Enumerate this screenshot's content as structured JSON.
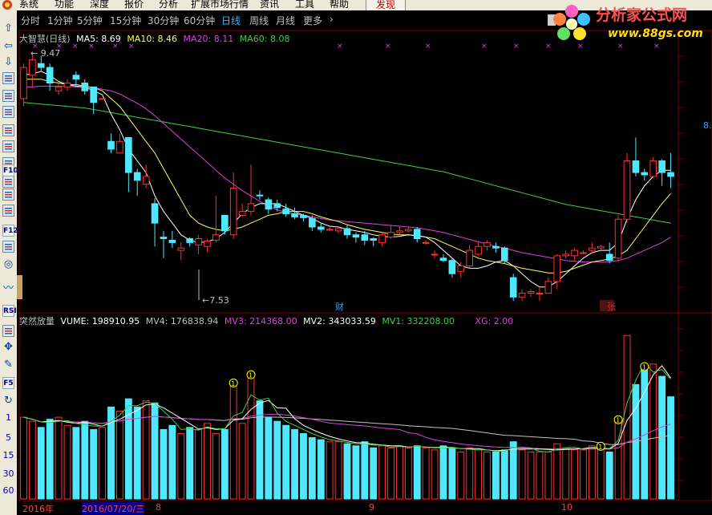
{
  "menu": {
    "items": [
      "系统",
      "功能",
      "深度",
      "报价",
      "分析",
      "扩展市场行情",
      "资讯",
      "工具",
      "帮助"
    ],
    "highlight": "发现"
  },
  "tabs": {
    "items": [
      "分时",
      "1分钟",
      "5分钟",
      "15分钟",
      "30分钟",
      "60分钟",
      "日线",
      "周线",
      "月线",
      "更多",
      "›"
    ],
    "active_index": 6
  },
  "toolbar": {
    "icons": [
      "arrow-up-icon",
      "arrow-left-icon",
      "arrow-down-icon",
      "stock-list-icon",
      "grid-icon",
      "table-icon",
      "line-chart-icon",
      "bar-chart-icon",
      "candlestick-icon",
      "list-icon",
      "f10-icon",
      "report-icon",
      "doc-icon",
      "f12-icon",
      "finance-icon",
      "circle-icon",
      "wave-icon",
      "rsi-icon",
      "ruler-icon",
      "move-icon",
      "pencil-icon",
      "f5-icon",
      "refresh-icon"
    ],
    "labels": {
      "f10": "F10",
      "f12": "F12",
      "rsi": "RSI",
      "f5": "F5"
    },
    "numbers": [
      "1",
      "5",
      "15",
      "30",
      "60"
    ]
  },
  "kline_header": {
    "title": "大智慧(日线)",
    "ma5": "MA5: 8.69",
    "ma10": "MA10: 8.46",
    "ma20": "MA20: 8.11",
    "ma60": "MA60: 8.08"
  },
  "kline_annotations": {
    "high": "9.47",
    "low": "7.53",
    "marker_cai": "财",
    "marker_zhang": "张",
    "right_price": "8."
  },
  "vol_header": {
    "title": "突然放量",
    "vume": "VUME: 198910.95",
    "mv4": "MV4: 176838.94",
    "mv3": "MV3: 214368.00",
    "mv2": "MV2: 343033.59",
    "mv1": "MV1: 332208.00",
    "xg": "XG: 2.00"
  },
  "logo": {
    "text": "分析家公式网",
    "url": "www.88gs.com"
  },
  "date_axis": {
    "year": "2016年",
    "selected": "2016/07/20/三",
    "m8": "8",
    "m9": "9",
    "m10": "10"
  },
  "colors": {
    "up": "#ff3030",
    "down": "#50e8ff",
    "ma5": "#ffffff",
    "ma10": "#ffff60",
    "ma20": "#e040e0",
    "ma60": "#40d040",
    "grid": "#800000",
    "marker": "#ffff00"
  },
  "chart_data": {
    "type": "candlestick",
    "candles": [
      [
        8.9,
        9.3,
        9.35,
        8.8
      ],
      [
        9.2,
        9.4,
        9.47,
        9.05
      ],
      [
        9.35,
        9.3,
        9.45,
        9.25
      ],
      [
        9.3,
        9.1,
        9.35,
        9.0
      ],
      [
        9.0,
        9.05,
        9.1,
        8.95
      ],
      [
        9.05,
        9.1,
        9.15,
        9.0
      ],
      [
        9.2,
        9.15,
        9.25,
        9.05
      ],
      [
        9.1,
        9.0,
        9.15,
        8.95
      ],
      [
        9.05,
        8.85,
        9.05,
        8.7
      ],
      [
        8.9,
        8.9,
        8.9,
        8.9
      ],
      [
        8.35,
        8.25,
        8.45,
        8.2
      ],
      [
        8.2,
        8.35,
        8.45,
        8.2
      ],
      [
        8.4,
        7.95,
        8.4,
        7.7
      ],
      [
        7.95,
        7.85,
        8.0,
        7.65
      ],
      [
        7.8,
        7.9,
        8.05,
        7.75
      ],
      [
        7.55,
        7.3,
        7.62,
        7.0
      ],
      [
        7.12,
        7.1,
        7.2,
        6.85
      ],
      [
        7.08,
        7.05,
        7.2,
        6.98
      ],
      [
        6.95,
        6.98,
        7.06,
        6.82
      ],
      [
        7.1,
        7.05,
        7.12,
        7.0
      ],
      [
        7.02,
        7.1,
        7.15,
        6.9
      ],
      [
        7.0,
        7.07,
        7.1,
        6.93
      ],
      [
        7.08,
        7.15,
        7.65,
        7.05
      ],
      [
        7.4,
        7.2,
        7.38,
        7.15
      ],
      [
        7.15,
        7.75,
        7.95,
        7.1
      ],
      [
        7.4,
        7.45,
        7.55,
        7.38
      ],
      [
        7.45,
        7.55,
        8.05,
        7.4
      ],
      [
        7.66,
        7.65,
        7.72,
        7.6
      ],
      [
        7.6,
        7.48,
        7.63,
        7.42
      ],
      [
        7.55,
        7.5,
        7.6,
        7.45
      ],
      [
        7.48,
        7.42,
        7.55,
        7.38
      ],
      [
        7.42,
        7.38,
        7.5,
        7.35
      ],
      [
        7.4,
        7.37,
        7.42,
        7.32
      ],
      [
        7.36,
        7.25,
        7.4,
        7.2
      ],
      [
        7.25,
        7.22,
        7.3,
        7.18
      ],
      [
        7.22,
        7.22,
        7.26,
        7.2
      ],
      [
        7.2,
        7.23,
        7.25,
        7.17
      ],
      [
        7.23,
        7.15,
        7.28,
        7.1
      ],
      [
        7.15,
        7.12,
        7.18,
        7.05
      ],
      [
        7.15,
        7.08,
        7.2,
        7.02
      ],
      [
        7.1,
        7.08,
        7.12,
        7.0
      ],
      [
        7.05,
        7.15,
        7.18,
        7.0
      ],
      [
        7.12,
        7.18,
        7.28,
        7.1
      ],
      [
        7.18,
        7.2,
        7.25,
        7.15
      ],
      [
        7.2,
        7.22,
        7.26,
        7.18
      ],
      [
        7.22,
        7.1,
        7.25,
        7.05
      ],
      [
        7.05,
        7.05,
        7.08,
        7.02
      ],
      [
        6.9,
        6.9,
        6.95,
        6.85
      ],
      [
        6.85,
        6.82,
        6.9,
        6.8
      ],
      [
        6.82,
        6.65,
        6.85,
        6.6
      ],
      [
        6.68,
        6.75,
        6.8,
        6.6
      ],
      [
        6.75,
        6.95,
        7.02,
        6.72
      ],
      [
        6.9,
        7.0,
        7.05,
        6.88
      ],
      [
        7.0,
        7.05,
        7.08,
        6.95
      ],
      [
        7.0,
        6.98,
        7.05,
        6.92
      ],
      [
        6.98,
        6.82,
        7.0,
        6.78
      ],
      [
        6.6,
        6.35,
        6.65,
        6.3
      ],
      [
        6.35,
        6.4,
        6.45,
        6.3
      ],
      [
        6.4,
        6.42,
        6.45,
        6.35
      ],
      [
        6.4,
        6.4,
        6.48,
        6.3
      ],
      [
        6.4,
        6.55,
        6.6,
        6.4
      ],
      [
        6.55,
        6.88,
        6.9,
        6.45
      ],
      [
        6.88,
        6.9,
        6.95,
        6.85
      ],
      [
        6.88,
        6.95,
        6.98,
        6.82
      ],
      [
        6.92,
        6.92,
        6.95,
        6.9
      ],
      [
        6.95,
        6.98,
        7.05,
        6.92
      ],
      [
        6.98,
        7.0,
        7.02,
        6.95
      ],
      [
        6.9,
        6.82,
        7.05,
        6.78
      ],
      [
        6.85,
        7.35,
        7.4,
        6.8
      ],
      [
        7.35,
        8.1,
        8.2,
        7.3
      ],
      [
        8.1,
        7.95,
        8.4,
        7.9
      ],
      [
        7.95,
        7.92,
        8.0,
        7.85
      ],
      [
        7.9,
        8.1,
        8.15,
        7.88
      ],
      [
        8.1,
        7.95,
        8.12,
        7.78
      ],
      [
        7.95,
        7.9,
        8.2,
        7.75
      ]
    ],
    "ma5": [
      9.2,
      9.22,
      9.25,
      9.2,
      9.12,
      9.08,
      9.06,
      9.05,
      9.0,
      8.95,
      8.7,
      8.5,
      8.25,
      8.1,
      7.95,
      7.65,
      7.45,
      7.3,
      7.15,
      7.08,
      7.05,
      7.06,
      7.1,
      7.18,
      7.3,
      7.42,
      7.5,
      7.55,
      7.55,
      7.55,
      7.5,
      7.45,
      7.4,
      7.36,
      7.3,
      7.26,
      7.25,
      7.22,
      7.2,
      7.18,
      7.15,
      7.13,
      7.12,
      7.13,
      7.15,
      7.14,
      7.12,
      7.05,
      6.95,
      6.85,
      6.75,
      6.72,
      6.72,
      6.75,
      6.8,
      6.82,
      6.75,
      6.65,
      6.55,
      6.48,
      6.48,
      6.55,
      6.65,
      6.75,
      6.85,
      6.92,
      6.95,
      6.95,
      7.05,
      7.35,
      7.6,
      7.78,
      7.9,
      7.98,
      7.98
    ],
    "ma10": [
      9.15,
      9.15,
      9.15,
      9.12,
      9.1,
      9.08,
      9.08,
      9.06,
      9.04,
      9.0,
      8.9,
      8.8,
      8.65,
      8.5,
      8.35,
      8.2,
      8.0,
      7.8,
      7.6,
      7.4,
      7.3,
      7.25,
      7.22,
      7.2,
      7.22,
      7.25,
      7.3,
      7.35,
      7.4,
      7.42,
      7.45,
      7.45,
      7.45,
      7.42,
      7.38,
      7.35,
      7.32,
      7.28,
      7.25,
      7.22,
      7.2,
      7.18,
      7.16,
      7.15,
      7.15,
      7.14,
      7.12,
      7.1,
      7.05,
      7.0,
      6.95,
      6.9,
      6.85,
      6.82,
      6.8,
      6.78,
      6.75,
      6.72,
      6.7,
      6.68,
      6.66,
      6.66,
      6.68,
      6.72,
      6.76,
      6.8,
      6.82,
      6.84,
      6.88,
      6.95,
      7.1,
      7.25,
      7.4,
      7.55,
      7.68
    ],
    "ma20": [
      9.05,
      9.05,
      9.06,
      9.06,
      9.06,
      9.06,
      9.05,
      9.05,
      9.04,
      9.02,
      9.0,
      8.96,
      8.9,
      8.84,
      8.77,
      8.68,
      8.58,
      8.48,
      8.38,
      8.28,
      8.18,
      8.08,
      7.98,
      7.88,
      7.8,
      7.72,
      7.65,
      7.58,
      7.52,
      7.47,
      7.44,
      7.42,
      7.4,
      7.38,
      7.36,
      7.34,
      7.33,
      7.32,
      7.31,
      7.3,
      7.29,
      7.28,
      7.27,
      7.26,
      7.25,
      7.24,
      7.22,
      7.2,
      7.18,
      7.15,
      7.12,
      7.09,
      7.06,
      7.03,
      7.0,
      6.98,
      6.95,
      6.92,
      6.9,
      6.88,
      6.86,
      6.84,
      6.82,
      6.81,
      6.8,
      6.8,
      6.8,
      6.8,
      6.82,
      6.85,
      6.9,
      6.95,
      7.0,
      7.05,
      7.12
    ],
    "ma60": [
      8.85,
      8.84,
      8.83,
      8.82,
      8.81,
      8.8,
      8.79,
      8.78,
      8.76,
      8.74,
      8.72,
      8.7,
      8.68,
      8.66,
      8.64,
      8.62,
      8.6,
      8.58,
      8.56,
      8.54,
      8.52,
      8.5,
      8.48,
      8.46,
      8.44,
      8.42,
      8.4,
      8.38,
      8.36,
      8.34,
      8.32,
      8.3,
      8.28,
      8.26,
      8.24,
      8.22,
      8.2,
      8.18,
      8.16,
      8.14,
      8.12,
      8.1,
      8.08,
      8.06,
      8.04,
      8.02,
      8.0,
      7.98,
      7.96,
      7.93,
      7.9,
      7.87,
      7.84,
      7.81,
      7.78,
      7.75,
      7.72,
      7.69,
      7.66,
      7.63,
      7.6,
      7.57,
      7.54,
      7.52,
      7.5,
      7.48,
      7.46,
      7.44,
      7.42,
      7.4,
      7.38,
      7.36,
      7.34,
      7.32,
      7.3
    ],
    "volume": [
      200,
      190,
      175,
      195,
      200,
      180,
      175,
      190,
      170,
      175,
      225,
      215,
      245,
      225,
      240,
      235,
      170,
      180,
      160,
      175,
      170,
      185,
      160,
      170,
      280,
      185,
      300,
      240,
      200,
      190,
      180,
      170,
      160,
      150,
      145,
      140,
      140,
      135,
      130,
      140,
      125,
      130,
      125,
      130,
      125,
      130,
      125,
      120,
      130,
      125,
      115,
      125,
      120,
      115,
      115,
      120,
      140,
      120,
      115,
      115,
      115,
      135,
      125,
      120,
      120,
      130,
      125,
      115,
      190,
      400,
      280,
      320,
      330,
      300,
      250
    ],
    "ylim_price": [
      6.25,
      9.6
    ],
    "ylim_volume": [
      0,
      420
    ],
    "markers_circle": [
      24,
      26,
      66,
      68,
      71
    ],
    "markers_big": [
      70
    ]
  }
}
